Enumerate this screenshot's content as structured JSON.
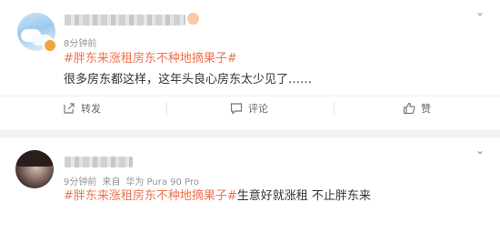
{
  "posts": [
    {
      "time": "8分钟前",
      "hashtag": "#胖东来涨租房东不种地摘果子#",
      "content": "很多房东都这样，这年头良心房东太少见了……",
      "actions": {
        "share": "转发",
        "comment": "评论",
        "like": "赞"
      }
    },
    {
      "time": "9分钟前",
      "source_prefix": "来自",
      "source": "华为 Pura 90 Pro",
      "hashtag": "#胖东来涨租房东不种地摘果子#",
      "content": "生意好就涨租 不止胖东来"
    }
  ]
}
